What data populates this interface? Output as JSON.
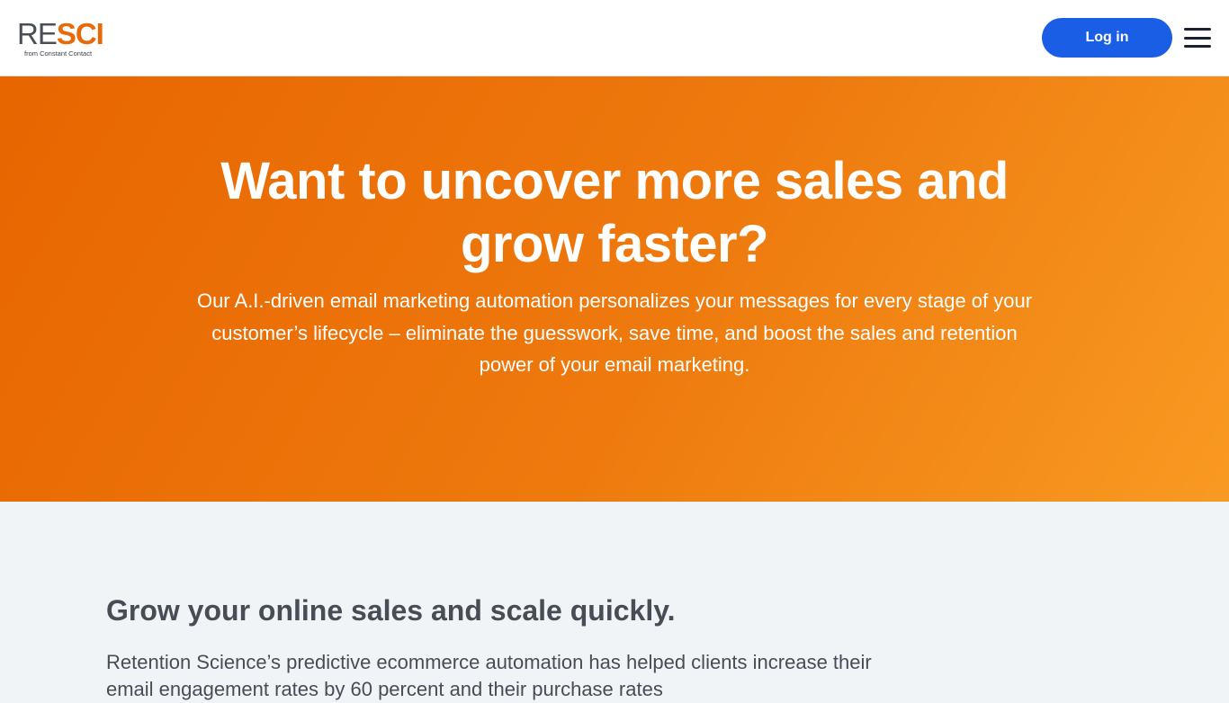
{
  "header": {
    "logo": {
      "re": "RE",
      "sci": "SCI",
      "tagline": "from Constant Contact"
    },
    "login_label": "Log in",
    "menu_icon": "hamburger-menu-icon"
  },
  "hero": {
    "title": "Want to uncover more sales and grow faster?",
    "text": "Our A.I.-driven email marketing automation personalizes your messages for every stage of your customer’s lifecycle – eliminate the guesswork, save time, and boost the sales and retention power of your email marketing."
  },
  "section": {
    "title": "Grow your online sales and scale quickly.",
    "text": "Retention Science’s predictive ecommerce automation has helped clients increase their email engagement rates by 60 percent and their purchase rates"
  },
  "colors": {
    "brand_orange": "#e8690a",
    "login_blue": "#1a5ee6",
    "hero_gradient_start": "#e86500",
    "hero_gradient_end": "#f89a22",
    "section_bg": "#f1f4f7"
  }
}
